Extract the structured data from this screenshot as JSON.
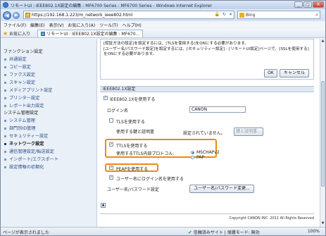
{
  "window": {
    "title": "リモートUI : IEEE802.1X設定の編集 : MF6700 Series : MF6700 Series - Windows Internet Explorer",
    "controls": {
      "minimize": "_",
      "maximize": "□",
      "close": "X"
    }
  },
  "addressbar": {
    "url": "https://192.168.1.223/m_network_ieee802.html",
    "lock": "🔒",
    "refresh": "↻",
    "stop": "✕",
    "search_placeholder": "Bing",
    "search_icon": "search-icon"
  },
  "menubar": {
    "items": [
      "ファイル(F)",
      "編集(E)",
      "表示(V)",
      "お気に入り(A)",
      "ツール(T)",
      "ヘルプ(H)"
    ]
  },
  "favbar": {
    "favorites_label": "お気に入り",
    "tab_label": "リモートUI : IEEE802.1X設定の編集 : MF670..."
  },
  "sidebar": {
    "categories": [
      {
        "label": "ファンクション設定",
        "items": [
          "共通設定",
          "コピー設定",
          "ファクス設定",
          "スキャン設定",
          "メディアプリント設定",
          "プリンター設定",
          "レポート出力設定"
        ]
      },
      {
        "label": "システム管理設定",
        "items": [
          "システム管理",
          "部門別ID管理",
          "セキュリティー設定",
          "ネットワーク設定",
          "通信管理設定/転送設定",
          "インポート/エクスポート",
          "設定情報の初期化"
        ]
      }
    ],
    "active_item": "ネットワーク設定"
  },
  "notice": {
    "lines": [
      "[認証方法の設定]を設定するには、[TLSを使用する]をONにする必要があります。",
      "[ユーザー名/パスワード設定]を設定するには、[セキュリティー設定] - [リモートUI設定]ページで、[SSLを使用する]をONにする必要があります。"
    ],
    "ok_label": "OK",
    "cancel_label": "キャンセル"
  },
  "ieee": {
    "section_title": "IEEE802.1X設定",
    "use_ieee_label": "IEEE802.1Xを使用する",
    "use_ieee_checked": true,
    "login_name_label": "ログイン名",
    "login_name_value": "CANON",
    "use_tls_label": "TLSを使用する",
    "use_tls_checked": false,
    "key_cert_label": "使用する鍵と証明書",
    "key_cert_status": "設定されていません。",
    "key_cert_button": "鍵と証明書...",
    "use_ttls_label": "TTLSを使用する",
    "use_ttls_checked": true,
    "ttls_protocol_label": "使用するTTLS内部プロトコル:",
    "ttls_options": [
      "MSCHAPv2",
      "PAP"
    ],
    "ttls_selected": "MSCHAPv2",
    "use_peap_label": "PEAPを使用する",
    "use_peap_checked": true,
    "use_user_login_label": "ユーザー名にログイン名を使用する",
    "use_user_login_checked": true,
    "user_pass_label": "ユーザー名/パスワード設定",
    "user_pass_button": "ユーザー名/パスワード変更..."
  },
  "footer": {
    "page_top": "▲",
    "copyright": "Copyright CANON INC. 2011 All Rights Reserved"
  },
  "status": {
    "left": "ページが表示されました",
    "zone": "信頼済みサイト | 保護モード: 無効",
    "zoom": "100%"
  }
}
